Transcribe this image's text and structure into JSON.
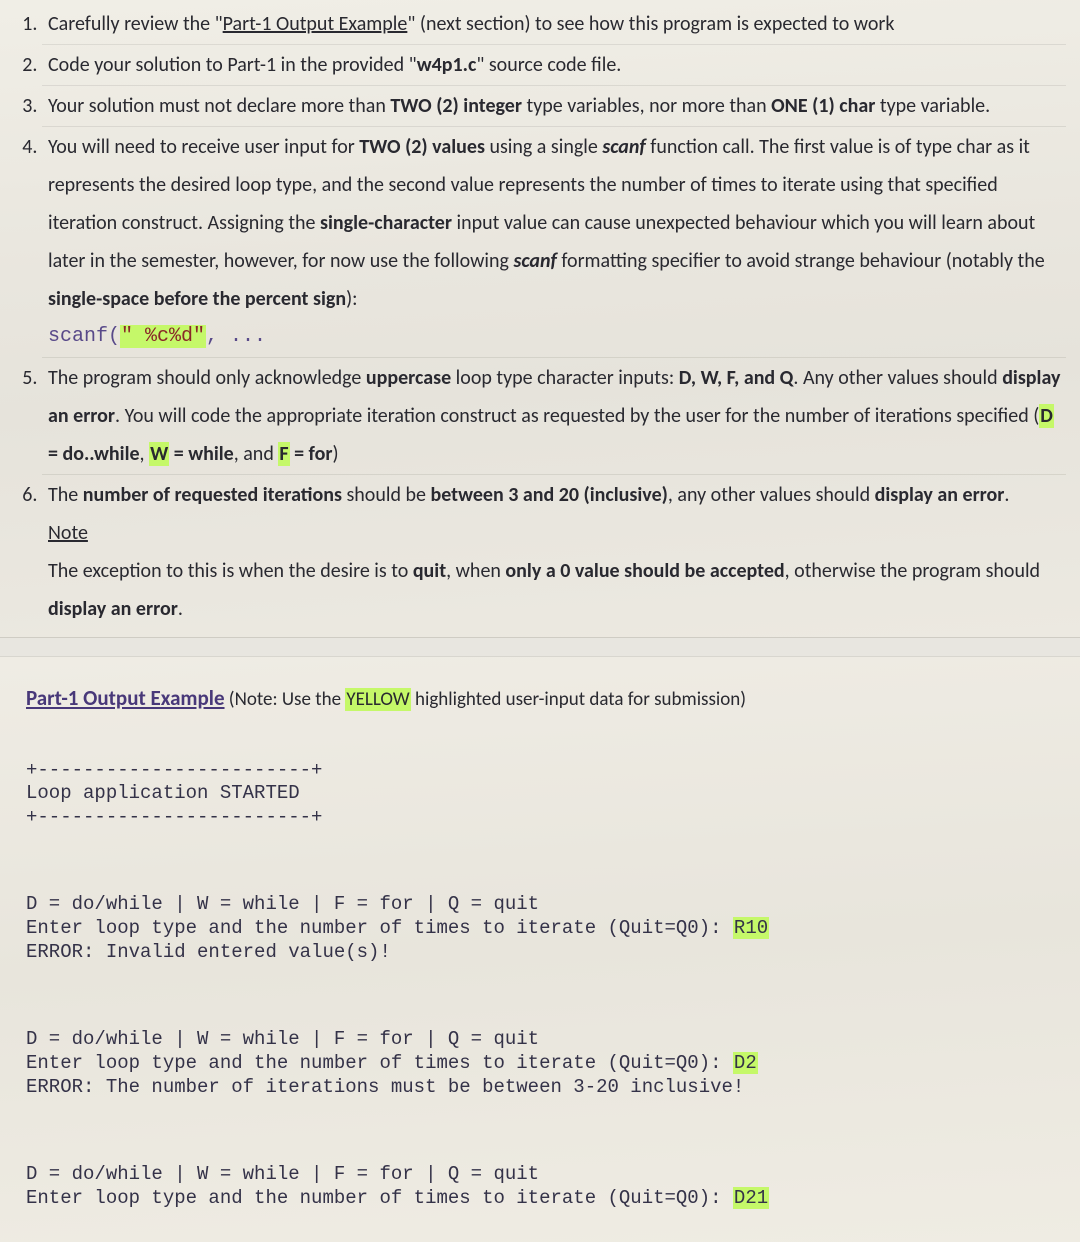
{
  "list": {
    "i1": {
      "pre": "Carefully review the \"",
      "link": "Part-1 Output Example",
      "post": "\" (next section) to see how this program is expected to work"
    },
    "i2": {
      "pre": "Code your solution to Part-1 in the provided \"",
      "file": "w4p1.c",
      "post": "\" source code file."
    },
    "i3": {
      "pre": "Your solution must not declare more than ",
      "two": "TWO (2) integer",
      "mid": " type variables, nor more than ",
      "one": "ONE (1) char",
      "post": " type variable."
    },
    "i4": {
      "a": "You will need to receive user input for ",
      "two": "TWO (2) values",
      "b": " using a single ",
      "sc1": "scanf",
      "c": " function call.  The first value is of type char as it represents the desired loop type, and the second value represents the number of times to iterate using that specified iteration construct.  Assigning the ",
      "single": "single-character",
      "d": " input value can cause unexpected behaviour which you will learn about later in the semester, however, for now use the following ",
      "sc2": "scanf",
      "e": " formatting specifier to avoid strange behaviour (notably the ",
      "space": "single-space before the percent sign",
      "f": "):",
      "code_pre": "scanf(",
      "code_str": "\" %c%d\"",
      "code_post": ", ..."
    },
    "i5": {
      "a": "The program should only acknowledge ",
      "up": "uppercase",
      "b": " loop type character inputs: ",
      "letters": "D, W, F, and Q",
      "c": ".  Any other values should ",
      "err": "display an error",
      "d": ". You will code the appropriate iteration construct as requested by the user for the number of iterations specified (",
      "D": "D",
      "dtxt": " = do..while",
      "sep1": ", ",
      "W": "W",
      "wtxt": " = while",
      "sep2": ", and ",
      "F": "F",
      "ftxt": " = for",
      "end": ")"
    },
    "i6": {
      "a": "The ",
      "nr": "number of requested iterations",
      "b": " should be ",
      "bt": "between 3 and 20 (inclusive)",
      "c": ", any other values should ",
      "err": "display an error",
      "d": ".",
      "note": "Note",
      "n1": "The exception to this is when the desire is to ",
      "quit": "quit",
      "n2": ", when ",
      "zero": "only a 0 value should be accepted",
      "n3": ", otherwise the program should ",
      "err2": "display an error",
      "n4": "."
    }
  },
  "out": {
    "title": "Part-1 Output Example",
    "note_a": " (Note: Use the ",
    "yellow": "YELLOW",
    "note_b": " highlighted user-input data for submission)",
    "l1": "+------------------------+",
    "l2": "Loop application STARTED",
    "l3": "+------------------------+",
    "g1": {
      "menu": "D = do/while | W = while | F = for | Q = quit",
      "prompt": "Enter loop type and the number of times to iterate (Quit=Q0): ",
      "inp": "R10",
      "res": "ERROR: Invalid entered value(s)!"
    },
    "g2": {
      "menu": "D = do/while | W = while | F = for | Q = quit",
      "prompt": "Enter loop type and the number of times to iterate (Quit=Q0): ",
      "inp": "D2",
      "res": "ERROR: The number of iterations must be between 3-20 inclusive!"
    },
    "g3": {
      "menu": "D = do/while | W = while | F = for | Q = quit",
      "prompt": "Enter loop type and the number of times to iterate (Quit=Q0): ",
      "inp": "D21"
    }
  }
}
